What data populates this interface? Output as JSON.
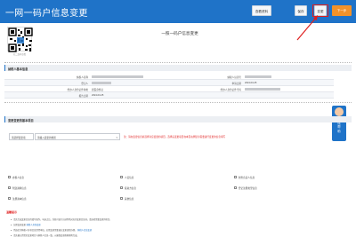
{
  "header": {
    "title": "一网一码户信息变更",
    "buttons": [
      "查看资料",
      "保存",
      "变更",
      "下一步"
    ]
  },
  "qr": {
    "label": "扫二维码查看"
  },
  "form": {
    "title": "一照一码户信息变更"
  },
  "section1": {
    "title": "纳税人基本信息",
    "rows": [
      {
        "l1": "纳税人名称",
        "v1": "",
        "l2": "纳税人识别号",
        "v2": ""
      },
      {
        "l1": "登记人",
        "v1": "",
        "l2": "申请日期",
        "v2": "2024-03-25"
      },
      {
        "l1": "经办人身份证件种类",
        "v1": "居民身份证",
        "l2": "经办人身份证件号码",
        "v2": ""
      },
      {
        "l1": "报告日期",
        "v1": "2024-03-25",
        "l2": "",
        "v2": ""
      }
    ]
  },
  "help": {
    "label": "在线帮助"
  },
  "section2": {
    "title": "变更变更的基本项目",
    "select_label": "请选择变更项",
    "select_value": "请输入变更的类别",
    "warning": "注：请在变更信息前选择对应变更的项目，选择后变更项目在本页右侧显示需要进行变更的信息填写",
    "options": [
      "办税人信息",
      "人员信息",
      "财务负责人信息",
      "附送资料信息",
      "投资方信息",
      "登记注册类型信息",
      "注册资本信息",
      "其他信息"
    ]
  },
  "notes": {
    "title": "温馨提示",
    "lines": [
      {
        "text": "请先完成变更信息的填写操作，勾选之后，系统可进行自动判断对应的变更信息前，请选择需要变更的项目。",
        "link": ""
      },
      {
        "text": "如需变更变更",
        "link": "纳税人身份变更"
      },
      {
        "text": "所选定的纳税人身份信息需经审核，如需变更需要通过变更流程办理。",
        "link": "纳税人信息变更"
      },
      {
        "text": "请先确认所需的变更项目与纳税人信息一致，以确保变更能够顺利完成。",
        "link": ""
      }
    ]
  },
  "colors": {
    "brand": "#1f73c8",
    "accent": "#f2922a",
    "alert": "#e02020"
  }
}
